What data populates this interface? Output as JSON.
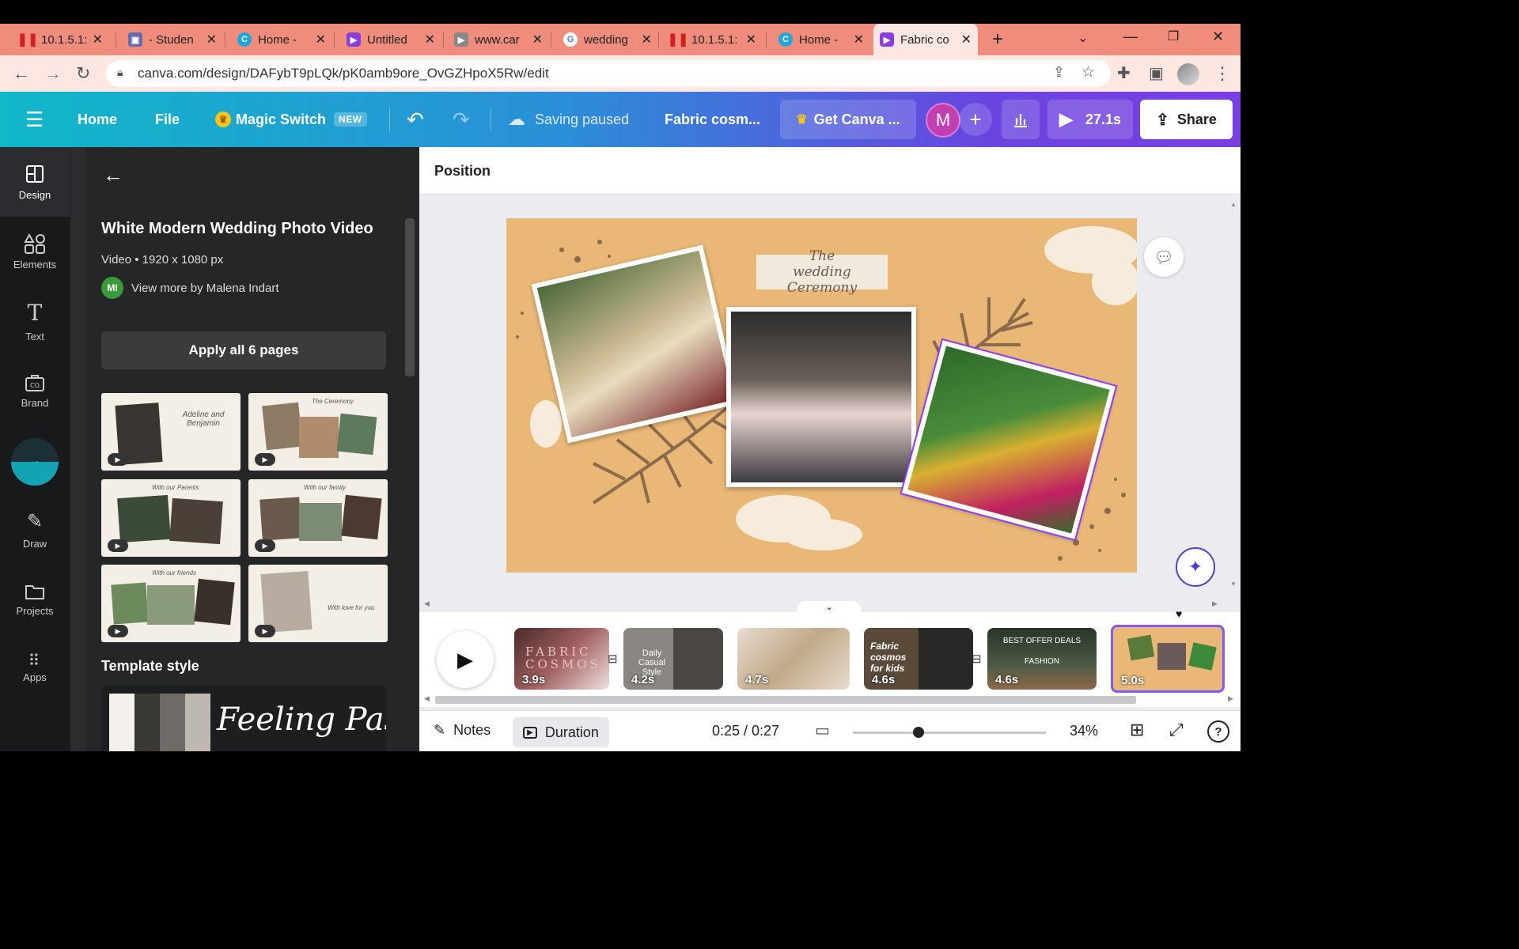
{
  "browser": {
    "tabs": [
      {
        "title": "10.1.5.1:",
        "icon": "pause-bars-icon"
      },
      {
        "title": "- Studen",
        "icon": "image-doc-icon"
      },
      {
        "title": "Home -",
        "icon": "canva-icon"
      },
      {
        "title": "Untitled",
        "icon": "video-icon"
      },
      {
        "title": "www.car",
        "icon": "play-icon"
      },
      {
        "title": "wedding",
        "icon": "google-icon"
      },
      {
        "title": "10.1.5.1:",
        "icon": "pause-bars-icon"
      },
      {
        "title": "Home -",
        "icon": "canva-icon"
      },
      {
        "title": "Fabric co",
        "icon": "video-icon"
      }
    ],
    "url": "canva.com/design/DAFybT9pLQk/pK0amb9ore_OvGZHpoX5Rw/edit"
  },
  "header": {
    "home": "Home",
    "file": "File",
    "magic_switch": "Magic Switch",
    "new_badge": "NEW",
    "saving": "Saving paused",
    "title": "Fabric cosm...",
    "get_canva": "Get Canva ...",
    "avatar_letter": "M",
    "play_time": "27.1s",
    "share": "Share"
  },
  "rail": {
    "items": [
      "Design",
      "Elements",
      "Text",
      "Brand",
      "Draw",
      "Projects",
      "Apps"
    ]
  },
  "panel": {
    "template_title": "White Modern Wedding Photo Video",
    "meta": "Video • 1920 x 1080 px",
    "author_initials": "MI",
    "author_link": "View more by Malena Indart",
    "apply_button": "Apply all 6 pages",
    "thumbs": [
      "Adeline and Benjamin",
      "The Ceremony",
      "With our Parents",
      "With our family",
      "With our friends",
      "With love for you"
    ],
    "style_heading": "Template style",
    "style_preview_text": "Feeling Passi"
  },
  "editor": {
    "position_label": "Position",
    "canvas_heading": "The wedding Ceremony",
    "colors": {
      "canvas_bg": "#e9b776",
      "leaf": "#8a6a4a",
      "selection": "#8b3dff"
    }
  },
  "timeline": {
    "clips": [
      {
        "duration": "3.9s",
        "text": "FABRIC COSMOS"
      },
      {
        "duration": "4.2s",
        "text": "Daily Casual Style"
      },
      {
        "duration": "4.7s",
        "text": ""
      },
      {
        "duration": "4.6s",
        "text": "Fabric cosmos for kids"
      },
      {
        "duration": "4.6s",
        "text": "BEST OFFER DEALS FASHION"
      },
      {
        "duration": "5.0s",
        "text": ""
      }
    ]
  },
  "bottom": {
    "notes": "Notes",
    "duration": "Duration",
    "time": "0:25 / 0:27",
    "zoom": "34%",
    "zoom_level": 0.34
  }
}
